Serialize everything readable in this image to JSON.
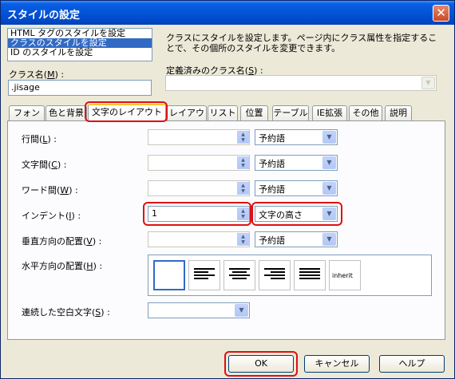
{
  "window": {
    "title": "スタイルの設定"
  },
  "target_list": {
    "items": [
      "HTML タグのスタイルを設定",
      "クラスのスタイルを設定",
      "ID のスタイルを設定"
    ],
    "selected_index": 1
  },
  "description": "クラスにスタイルを設定します。ページ内にクラス属性を指定することで、その個所のスタイルを変更できます。",
  "class_name": {
    "label": "クラス名(M) :",
    "value": ".jisage"
  },
  "defined_class": {
    "label": "定義済みのクラス名(S) :",
    "value": ""
  },
  "tabs": [
    "フォント",
    "色と背景",
    "文字のレイアウト",
    "レイアウト",
    "リスト",
    "位置",
    "テーブル",
    "IE拡張",
    "その他",
    "説明"
  ],
  "active_tab": "文字のレイアウト",
  "rows": {
    "line_height": {
      "label": "行間(L) :",
      "value": "",
      "unit": "予約語"
    },
    "letter_spacing": {
      "label": "文字間(C) :",
      "value": "",
      "unit": "予約語"
    },
    "word_spacing": {
      "label": "ワード間(W) :",
      "value": "",
      "unit": "予約語"
    },
    "indent": {
      "label": "インデント(I) :",
      "value": "1",
      "unit": "文字の高さ"
    },
    "vertical_align": {
      "label": "垂直方向の配置(V) :",
      "value": "",
      "unit": "予約語"
    },
    "text_align": {
      "label": "水平方向の配置(H) :",
      "options": [
        "none",
        "left",
        "center",
        "right",
        "justify",
        "inherit"
      ],
      "inherit_label": "inherit"
    },
    "white_space": {
      "label": "連続した空白文字(S) :",
      "value": ""
    }
  },
  "buttons": {
    "ok": "OK",
    "cancel": "キャンセル",
    "help": "ヘルプ"
  },
  "colors": {
    "title_bar": "#0453d6",
    "highlight": "#e01010",
    "selection": "#316ac5"
  }
}
